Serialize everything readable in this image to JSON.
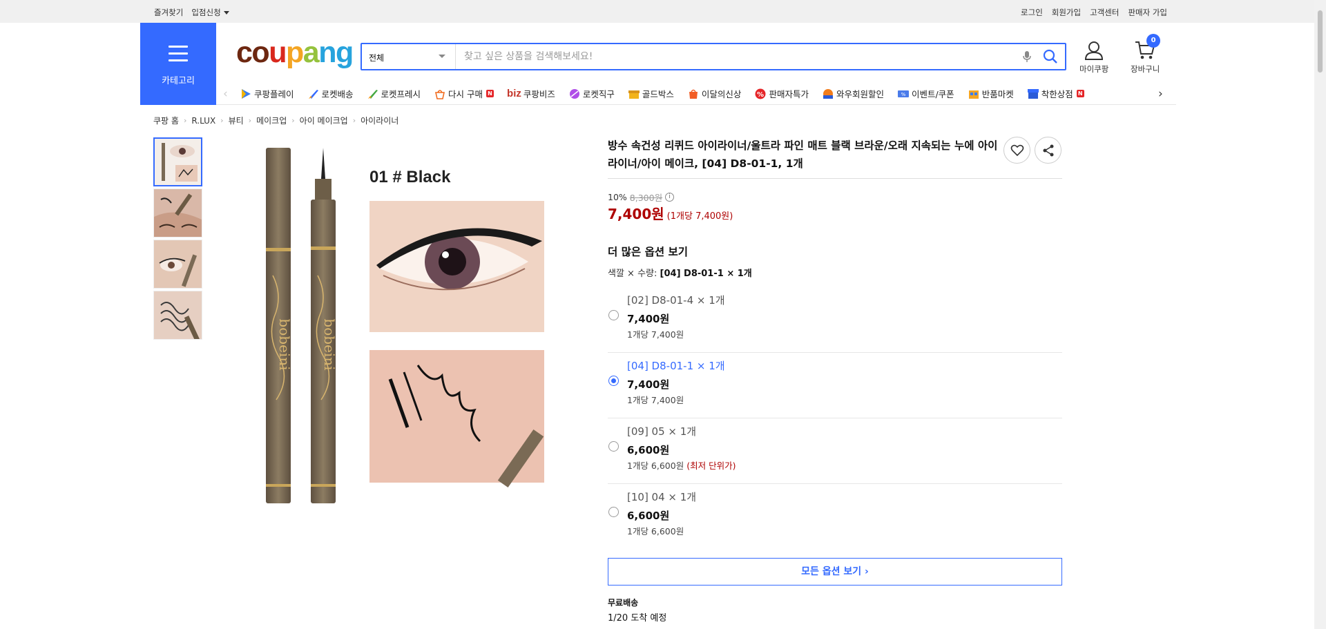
{
  "topbar": {
    "left": [
      "즐겨찾기",
      "입점신청"
    ],
    "right": [
      "로그인",
      "회원가입",
      "고객센터",
      "판매자 가입"
    ]
  },
  "header": {
    "category_label": "카테고리",
    "logo": [
      "c",
      "o",
      "u",
      "p",
      "a",
      "n",
      "g"
    ],
    "search_scope": "전체",
    "search_placeholder": "찾고 싶은 상품을 검색해보세요!",
    "mypage_label": "마이쿠팡",
    "cart_label": "장바구니",
    "cart_count": "0"
  },
  "nav": [
    {
      "label": "쿠팡플레이",
      "icon": "play-icon"
    },
    {
      "label": "로켓배송",
      "icon": "rocket-icon"
    },
    {
      "label": "로켓프레시",
      "icon": "rocket-fresh-icon"
    },
    {
      "label": "다시 구매",
      "icon": "rebuy-icon",
      "badge": "N"
    },
    {
      "label": "쿠팡비즈",
      "prefix": "biz"
    },
    {
      "label": "로켓직구",
      "icon": "global-icon"
    },
    {
      "label": "골드박스",
      "icon": "goldbox-icon"
    },
    {
      "label": "이달의신상",
      "icon": "new-icon"
    },
    {
      "label": "판매자특가",
      "icon": "percent-icon"
    },
    {
      "label": "와우회원할인",
      "icon": "wow-icon"
    },
    {
      "label": "이벤트/쿠폰",
      "icon": "coupon-icon"
    },
    {
      "label": "반품마켓",
      "icon": "return-market-icon"
    },
    {
      "label": "착한상점",
      "icon": "store-icon",
      "badge": "N"
    }
  ],
  "breadcrumb": [
    "쿠팡 홈",
    "R.LUX",
    "뷰티",
    "메이크업",
    "아이 메이크업",
    "아이라이너"
  ],
  "product": {
    "title": "방수 속건성 리퀴드 아이라이너/울트라 파인 매트 블랙 브라운/오래 지속되는 누에 아이라이너/아이 메이크, [04] D8-01-1, 1개",
    "image_caption": "01 # Black",
    "image_brand": "bobeini",
    "discount_rate": "10%",
    "original_price": "8,300원",
    "sale_price": "7,400원",
    "unit_price": "(1개당 7,400원)",
    "options_heading": "더 많은 옵션 보기",
    "selected_label": "색깔 × 수량:",
    "selected_value": "[04] D8-01-1 × 1개",
    "options": [
      {
        "name": "[02] D8-01-4 × 1개",
        "price": "7,400원",
        "unit": "1개당 7,400원",
        "note": "",
        "selected": false
      },
      {
        "name": "[04] D8-01-1 × 1개",
        "price": "7,400원",
        "unit": "1개당 7,400원",
        "note": "",
        "selected": true
      },
      {
        "name": "[09] 05 × 1개",
        "price": "6,600원",
        "unit": "1개당 6,600원",
        "note": "(최저 단위가)",
        "selected": false
      },
      {
        "name": "[10] 04 × 1개",
        "price": "6,600원",
        "unit": "1개당 6,600원",
        "note": "",
        "selected": false
      }
    ],
    "all_options_label": "모든 옵션 보기 ›",
    "shipping_type": "무료배송",
    "delivery_eta": "1/20 도착 예정"
  },
  "colors": {
    "accent": "#346aff",
    "price_red": "#ae0000"
  }
}
